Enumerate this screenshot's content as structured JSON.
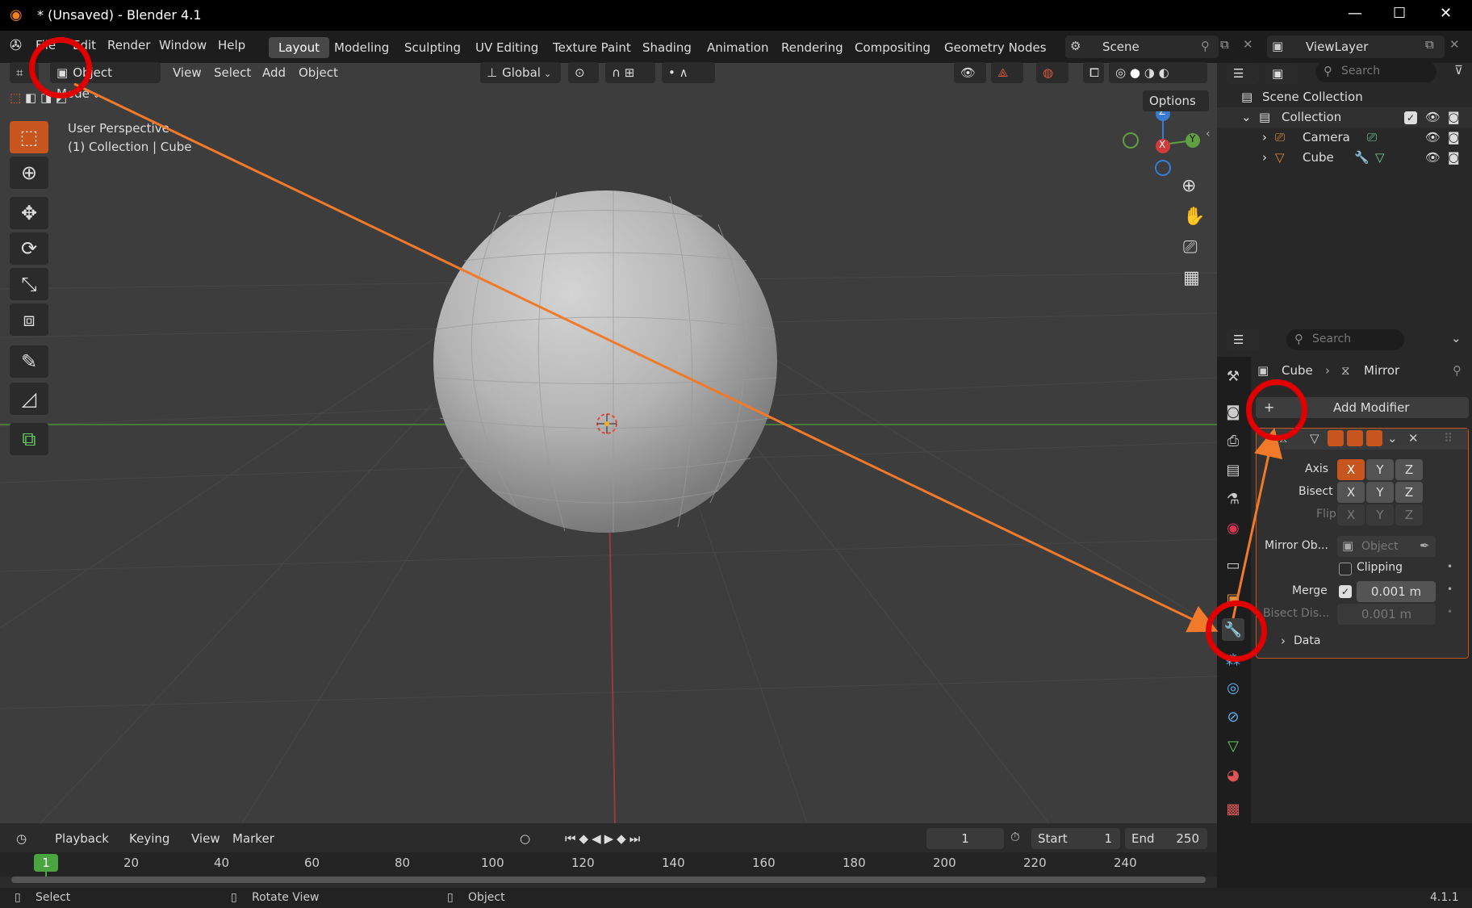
{
  "window": {
    "title": "* (Unsaved) - Blender 4.1",
    "minimize": "—",
    "maximize": "☐",
    "close": "✕"
  },
  "menus": [
    "File",
    "Edit",
    "Render",
    "Window",
    "Help"
  ],
  "workspaces": [
    "Layout",
    "Modeling",
    "Sculpting",
    "UV Editing",
    "Texture Paint",
    "Shading",
    "Animation",
    "Rendering",
    "Compositing",
    "Geometry Nodes"
  ],
  "scene": {
    "name": "Scene",
    "view_layer": "ViewLayer"
  },
  "viewport": {
    "mode": "Object Mode",
    "menu": [
      "View",
      "Select",
      "Add",
      "Object"
    ],
    "orientation": "Global",
    "options": "Options",
    "overlay_line1": "User Perspective",
    "overlay_line2": "(1) Collection | Cube",
    "gizmo": {
      "x": "X",
      "y": "Y",
      "z": "Z"
    }
  },
  "outliner": {
    "search_placeholder": "Search",
    "scene_collection": "Scene Collection",
    "collection": "Collection",
    "items": [
      "Camera",
      "Cube"
    ]
  },
  "properties": {
    "search_placeholder": "Search",
    "breadcrumb_object": "Cube",
    "breadcrumb_modifier": "Mirror",
    "add_modifier": "Add Modifier",
    "add_modifier_plus": "+",
    "axis_label": "Axis",
    "bisect_label": "Bisect",
    "flip_label": "Flip",
    "axes": [
      "X",
      "Y",
      "Z"
    ],
    "mirror_object_label": "Mirror Ob...",
    "mirror_object_placeholder": "Object",
    "clipping_label": "Clipping",
    "merge_label": "Merge",
    "merge_value": "0.001 m",
    "bisect_distance_label": "Bisect Dis...",
    "bisect_distance_value": "0.001 m",
    "data_label": "Data"
  },
  "timeline": {
    "menus": [
      "Playback",
      "Keying",
      "View",
      "Marker"
    ],
    "current_frame": "1",
    "start_label": "Start",
    "start_value": "1",
    "end_label": "End",
    "end_value": "250",
    "ticks": [
      "20",
      "40",
      "60",
      "80",
      "100",
      "120",
      "140",
      "160",
      "180",
      "200",
      "220",
      "240"
    ],
    "playhead": "1"
  },
  "statusbar": {
    "select": "Select",
    "rotate": "Rotate View",
    "object": "Object",
    "version": "4.1.1"
  },
  "colors": {
    "accent": "#c8541e",
    "annotation_red": "#e00000",
    "arrow_orange": "#f07a2a",
    "active_axis": "#c8541e"
  }
}
